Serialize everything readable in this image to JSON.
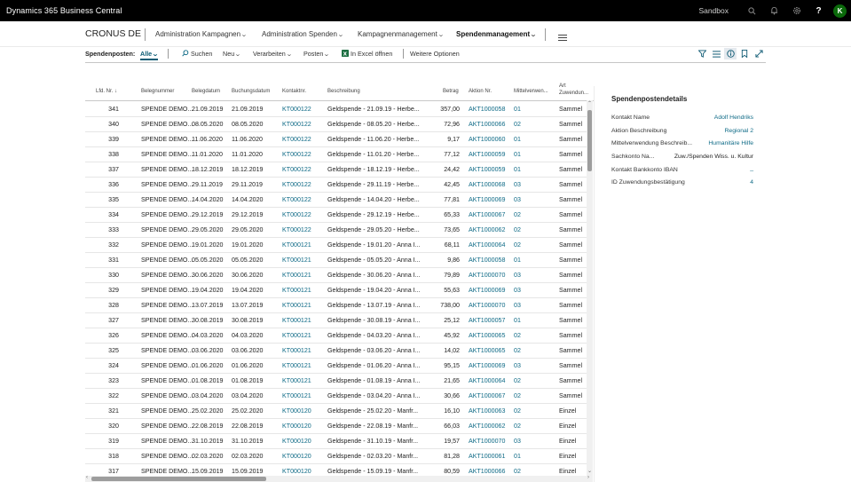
{
  "topbar": {
    "app_title": "Dynamics 365 Business Central",
    "environment": "Sandbox",
    "avatar_initial": "K",
    "help_label": "?"
  },
  "navbar": {
    "company": "CRONUS DE",
    "items": [
      {
        "label": "Administration Kampagnen"
      },
      {
        "label": "Administration Spenden"
      },
      {
        "label": "Kampagnenmanagement"
      },
      {
        "label": "Spendenmanagement"
      }
    ]
  },
  "actionbar": {
    "page_caption": "Spendenposten:",
    "filter_view": "Alle",
    "search_label": "Suchen",
    "new_label": "Neu",
    "process_label": "Verarbeiten",
    "entries_label": "Posten",
    "excel_label": "In Excel öffnen",
    "more_label": "Weitere Optionen"
  },
  "table": {
    "headers": {
      "lfd": "Lfd. Nr.",
      "sort_arrow": "↓",
      "beleg": "Belegnummer",
      "belegdatum": "Belegdatum",
      "buchungsdatum": "Buchungsdatum",
      "kontakt": "Kontaktnr.",
      "beschreibung": "Beschreibung",
      "betrag": "Betrag",
      "aktion": "Aktion Nr.",
      "mittel": "Mittelverwen...",
      "art_line1": "Art",
      "art_line2": "Zuwendun..."
    },
    "rows": [
      {
        "nr": "341",
        "beleg": "SPENDE DEMO...",
        "belegdatum": "21.09.2019",
        "buchungsdatum": "21.09.2019",
        "kontakt": "KT000122",
        "beschreibung": "Geldspende - 21.09.19 - Herbe...",
        "betrag": "357,00",
        "aktion": "AKT1000058",
        "mittel": "01",
        "art": "Sammel"
      },
      {
        "nr": "340",
        "beleg": "SPENDE DEMO...",
        "belegdatum": "08.05.2020",
        "buchungsdatum": "08.05.2020",
        "kontakt": "KT000122",
        "beschreibung": "Geldspende - 08.05.20 - Herbe...",
        "betrag": "72,96",
        "aktion": "AKT1000066",
        "mittel": "02",
        "art": "Sammel"
      },
      {
        "nr": "339",
        "beleg": "SPENDE DEMO...",
        "belegdatum": "11.06.2020",
        "buchungsdatum": "11.06.2020",
        "kontakt": "KT000122",
        "beschreibung": "Geldspende - 11.06.20 - Herbe...",
        "betrag": "9,17",
        "aktion": "AKT1000060",
        "mittel": "01",
        "art": "Sammel"
      },
      {
        "nr": "338",
        "beleg": "SPENDE DEMO...",
        "belegdatum": "11.01.2020",
        "buchungsdatum": "11.01.2020",
        "kontakt": "KT000122",
        "beschreibung": "Geldspende - 11.01.20 - Herbe...",
        "betrag": "77,12",
        "aktion": "AKT1000059",
        "mittel": "01",
        "art": "Sammel"
      },
      {
        "nr": "337",
        "beleg": "SPENDE DEMO...",
        "belegdatum": "18.12.2019",
        "buchungsdatum": "18.12.2019",
        "kontakt": "KT000122",
        "beschreibung": "Geldspende - 18.12.19 - Herbe...",
        "betrag": "24,42",
        "aktion": "AKT1000059",
        "mittel": "01",
        "art": "Sammel"
      },
      {
        "nr": "336",
        "beleg": "SPENDE DEMO...",
        "belegdatum": "29.11.2019",
        "buchungsdatum": "29.11.2019",
        "kontakt": "KT000122",
        "beschreibung": "Geldspende - 29.11.19 - Herbe...",
        "betrag": "42,45",
        "aktion": "AKT1000068",
        "mittel": "03",
        "art": "Sammel"
      },
      {
        "nr": "335",
        "beleg": "SPENDE DEMO...",
        "belegdatum": "14.04.2020",
        "buchungsdatum": "14.04.2020",
        "kontakt": "KT000122",
        "beschreibung": "Geldspende - 14.04.20 - Herbe...",
        "betrag": "77,81",
        "aktion": "AKT1000069",
        "mittel": "03",
        "art": "Sammel"
      },
      {
        "nr": "334",
        "beleg": "SPENDE DEMO...",
        "belegdatum": "29.12.2019",
        "buchungsdatum": "29.12.2019",
        "kontakt": "KT000122",
        "beschreibung": "Geldspende - 29.12.19 - Herbe...",
        "betrag": "65,33",
        "aktion": "AKT1000067",
        "mittel": "02",
        "art": "Sammel"
      },
      {
        "nr": "333",
        "beleg": "SPENDE DEMO...",
        "belegdatum": "29.05.2020",
        "buchungsdatum": "29.05.2020",
        "kontakt": "KT000122",
        "beschreibung": "Geldspende - 29.05.20 - Herbe...",
        "betrag": "73,65",
        "aktion": "AKT1000062",
        "mittel": "02",
        "art": "Sammel"
      },
      {
        "nr": "332",
        "beleg": "SPENDE DEMO...",
        "belegdatum": "19.01.2020",
        "buchungsdatum": "19.01.2020",
        "kontakt": "KT000121",
        "beschreibung": "Geldspende - 19.01.20 - Anna I...",
        "betrag": "68,11",
        "aktion": "AKT1000064",
        "mittel": "02",
        "art": "Sammel"
      },
      {
        "nr": "331",
        "beleg": "SPENDE DEMO...",
        "belegdatum": "05.05.2020",
        "buchungsdatum": "05.05.2020",
        "kontakt": "KT000121",
        "beschreibung": "Geldspende - 05.05.20 - Anna I...",
        "betrag": "9,86",
        "aktion": "AKT1000058",
        "mittel": "01",
        "art": "Sammel"
      },
      {
        "nr": "330",
        "beleg": "SPENDE DEMO...",
        "belegdatum": "30.06.2020",
        "buchungsdatum": "30.06.2020",
        "kontakt": "KT000121",
        "beschreibung": "Geldspende - 30.06.20 - Anna I...",
        "betrag": "79,89",
        "aktion": "AKT1000070",
        "mittel": "03",
        "art": "Sammel"
      },
      {
        "nr": "329",
        "beleg": "SPENDE DEMO...",
        "belegdatum": "19.04.2020",
        "buchungsdatum": "19.04.2020",
        "kontakt": "KT000121",
        "beschreibung": "Geldspende - 19.04.20 - Anna I...",
        "betrag": "55,63",
        "aktion": "AKT1000069",
        "mittel": "03",
        "art": "Sammel"
      },
      {
        "nr": "328",
        "beleg": "SPENDE DEMO...",
        "belegdatum": "13.07.2019",
        "buchungsdatum": "13.07.2019",
        "kontakt": "KT000121",
        "beschreibung": "Geldspende - 13.07.19 - Anna I...",
        "betrag": "738,00",
        "aktion": "AKT1000070",
        "mittel": "03",
        "art": "Sammel"
      },
      {
        "nr": "327",
        "beleg": "SPENDE DEMO...",
        "belegdatum": "30.08.2019",
        "buchungsdatum": "30.08.2019",
        "kontakt": "KT000121",
        "beschreibung": "Geldspende - 30.08.19 - Anna I...",
        "betrag": "25,12",
        "aktion": "AKT1000057",
        "mittel": "01",
        "art": "Sammel"
      },
      {
        "nr": "326",
        "beleg": "SPENDE DEMO...",
        "belegdatum": "04.03.2020",
        "buchungsdatum": "04.03.2020",
        "kontakt": "KT000121",
        "beschreibung": "Geldspende - 04.03.20 - Anna I...",
        "betrag": "45,92",
        "aktion": "AKT1000065",
        "mittel": "02",
        "art": "Sammel"
      },
      {
        "nr": "325",
        "beleg": "SPENDE DEMO...",
        "belegdatum": "03.06.2020",
        "buchungsdatum": "03.06.2020",
        "kontakt": "KT000121",
        "beschreibung": "Geldspende - 03.06.20 - Anna I...",
        "betrag": "14,02",
        "aktion": "AKT1000065",
        "mittel": "02",
        "art": "Sammel"
      },
      {
        "nr": "324",
        "beleg": "SPENDE DEMO...",
        "belegdatum": "01.06.2020",
        "buchungsdatum": "01.06.2020",
        "kontakt": "KT000121",
        "beschreibung": "Geldspende - 01.06.20 - Anna I...",
        "betrag": "95,15",
        "aktion": "AKT1000069",
        "mittel": "03",
        "art": "Sammel"
      },
      {
        "nr": "323",
        "beleg": "SPENDE DEMO...",
        "belegdatum": "01.08.2019",
        "buchungsdatum": "01.08.2019",
        "kontakt": "KT000121",
        "beschreibung": "Geldspende - 01.08.19 - Anna I...",
        "betrag": "21,65",
        "aktion": "AKT1000064",
        "mittel": "02",
        "art": "Sammel"
      },
      {
        "nr": "322",
        "beleg": "SPENDE DEMO...",
        "belegdatum": "03.04.2020",
        "buchungsdatum": "03.04.2020",
        "kontakt": "KT000121",
        "beschreibung": "Geldspende - 03.04.20 - Anna I...",
        "betrag": "30,66",
        "aktion": "AKT1000067",
        "mittel": "02",
        "art": "Sammel"
      },
      {
        "nr": "321",
        "beleg": "SPENDE DEMO...",
        "belegdatum": "25.02.2020",
        "buchungsdatum": "25.02.2020",
        "kontakt": "KT000120",
        "beschreibung": "Geldspende - 25.02.20 - Manfr...",
        "betrag": "16,10",
        "aktion": "AKT1000063",
        "mittel": "02",
        "art": "Einzel"
      },
      {
        "nr": "320",
        "beleg": "SPENDE DEMO...",
        "belegdatum": "22.08.2019",
        "buchungsdatum": "22.08.2019",
        "kontakt": "KT000120",
        "beschreibung": "Geldspende - 22.08.19 - Manfr...",
        "betrag": "66,03",
        "aktion": "AKT1000062",
        "mittel": "02",
        "art": "Einzel"
      },
      {
        "nr": "319",
        "beleg": "SPENDE DEMO...",
        "belegdatum": "31.10.2019",
        "buchungsdatum": "31.10.2019",
        "kontakt": "KT000120",
        "beschreibung": "Geldspende - 31.10.19 - Manfr...",
        "betrag": "19,57",
        "aktion": "AKT1000070",
        "mittel": "03",
        "art": "Einzel"
      },
      {
        "nr": "318",
        "beleg": "SPENDE DEMO...",
        "belegdatum": "02.03.2020",
        "buchungsdatum": "02.03.2020",
        "kontakt": "KT000120",
        "beschreibung": "Geldspende - 02.03.20 - Manfr...",
        "betrag": "81,28",
        "aktion": "AKT1000061",
        "mittel": "01",
        "art": "Einzel"
      },
      {
        "nr": "317",
        "beleg": "SPENDE DEMO...",
        "belegdatum": "15.09.2019",
        "buchungsdatum": "15.09.2019",
        "kontakt": "KT000120",
        "beschreibung": "Geldspende - 15.09.19 - Manfr...",
        "betrag": "80,59",
        "aktion": "AKT1000066",
        "mittel": "02",
        "art": "Einzel"
      }
    ]
  },
  "factbox": {
    "title": "Spendenpostendetails",
    "fields": [
      {
        "label": "Kontakt Name",
        "value": "Adolf Hendriks",
        "link": true
      },
      {
        "label": "Aktion Beschreibung",
        "value": "Regional 2",
        "link": true
      },
      {
        "label": "Mittelverwendung Beschreib...",
        "value": "Humanitäre Hilfe",
        "link": true
      },
      {
        "label": "Sachkonto Na...",
        "value": "Zuw./Spenden Wiss. u. Kultur",
        "link": false
      },
      {
        "label": "Kontakt Bankkonto IBAN",
        "value": "_",
        "link": true
      },
      {
        "label": "ID Zuwendungsbestätigung",
        "value": "4",
        "link": true
      }
    ]
  }
}
